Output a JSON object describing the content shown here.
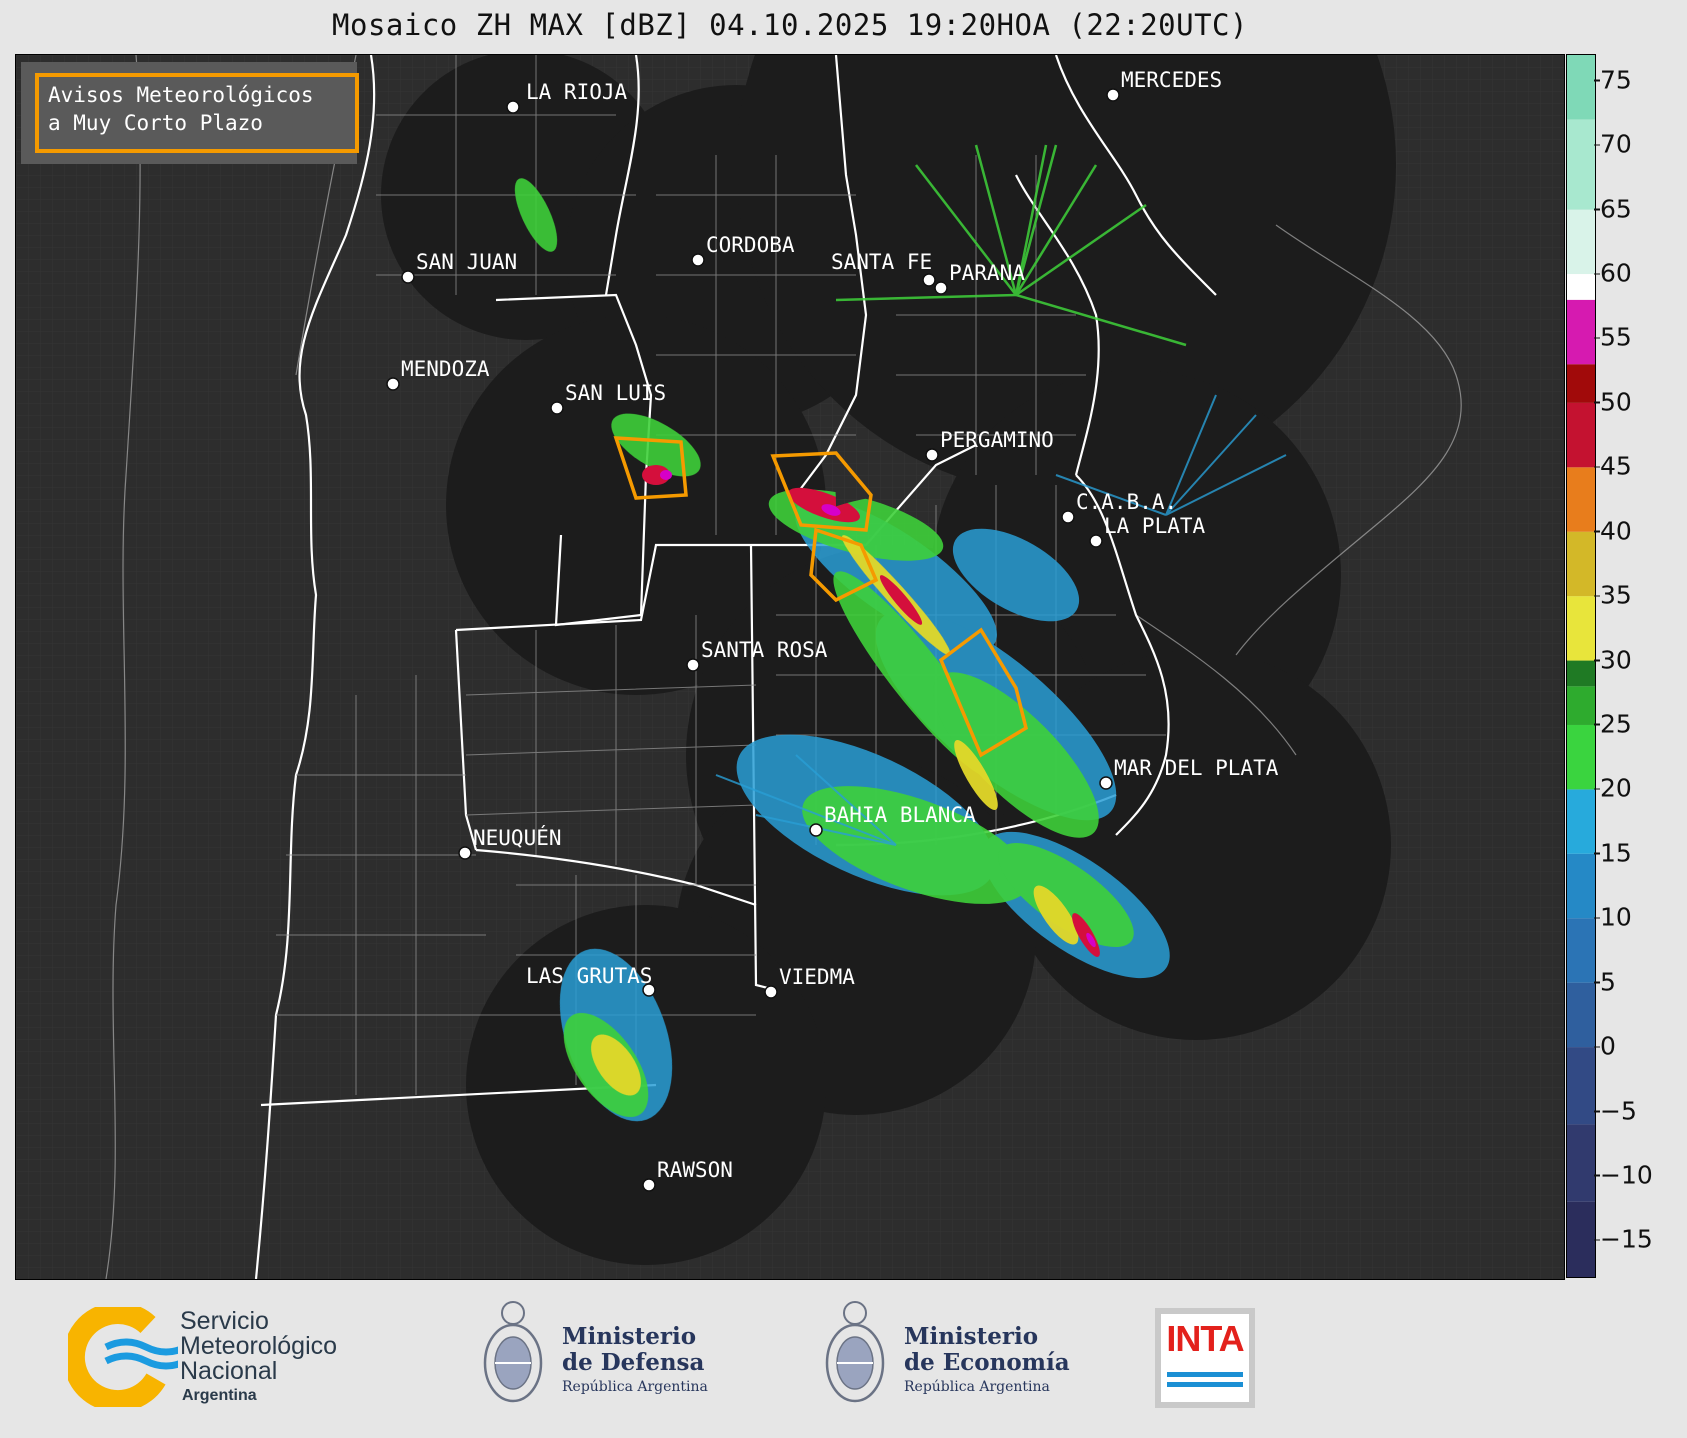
{
  "title": "Mosaico ZH MAX [dBZ] 04.10.2025 19:20HOA (22:20UTC)",
  "avisos_box": {
    "line1": "Avisos Meteorológicos",
    "line2": "a Muy Corto Plazo",
    "border_color": "#f59a00"
  },
  "cities": [
    {
      "name": "LA RIOJA"
    },
    {
      "name": "MERCEDES"
    },
    {
      "name": "CORDOBA"
    },
    {
      "name": "SAN JUAN"
    },
    {
      "name": "SANTA FE"
    },
    {
      "name": "PARANA"
    },
    {
      "name": "MENDOZA"
    },
    {
      "name": "SAN LUIS"
    },
    {
      "name": "PERGAMINO"
    },
    {
      "name": "C.A.B.A."
    },
    {
      "name": "LA PLATA"
    },
    {
      "name": "SANTA ROSA"
    },
    {
      "name": "MAR DEL PLATA"
    },
    {
      "name": "BAHIA BLANCA"
    },
    {
      "name": "NEUQUÉN"
    },
    {
      "name": "LAS GRUTAS"
    },
    {
      "name": "VIEDMA"
    },
    {
      "name": "RAWSON"
    }
  ],
  "colorbar": {
    "unit": "dBZ",
    "ticks": [
      "75",
      "70",
      "65",
      "60",
      "55",
      "50",
      "45",
      "40",
      "35",
      "30",
      "25",
      "20",
      "15",
      "10",
      "5",
      "0",
      "−5",
      "−10",
      "−15"
    ],
    "range": [
      -18,
      77
    ]
  },
  "logos": {
    "smn": {
      "line1": "Servicio",
      "line2": "Meteorológico",
      "line3": "Nacional",
      "line4": "Argentina",
      "icon": "smn-logo-icon"
    },
    "defensa": {
      "line1": "Ministerio",
      "line2": "de Defensa",
      "line3": "República Argentina",
      "icon": "argentina-coat-of-arms-icon"
    },
    "economia": {
      "line1": "Ministerio",
      "line2": "de Economía",
      "line3": "República Argentina",
      "icon": "argentina-coat-of-arms-icon"
    },
    "inta": {
      "text": "INTA",
      "color": "#e3211c"
    }
  }
}
